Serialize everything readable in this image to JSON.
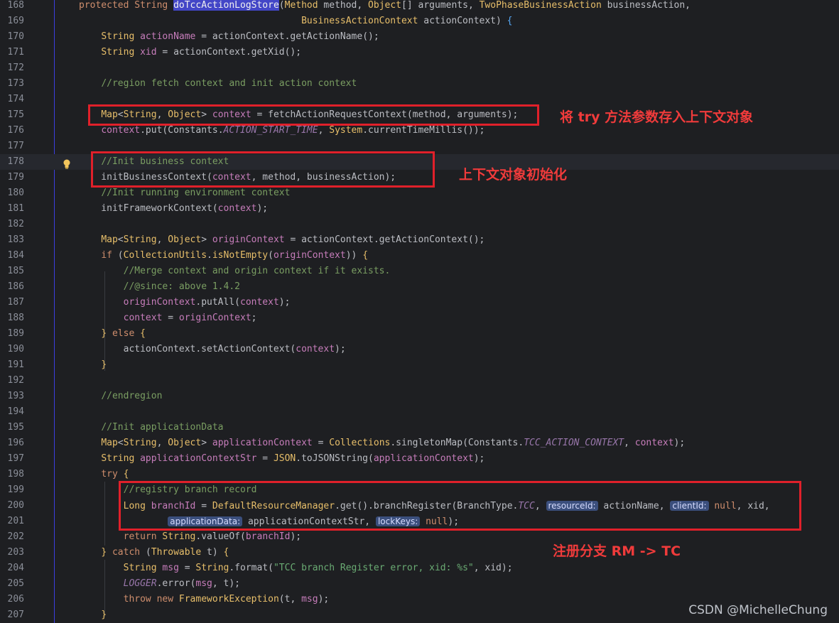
{
  "annotations": {
    "a1": "将 try 方法参数存入上下文对象",
    "a2": "上下文对象初始化",
    "a3": "注册分支 RM -> TC"
  },
  "watermark": "CSDN @MichelleChung",
  "lines": [
    {
      "n": "168",
      "s": [
        [
          "k",
          "protected "
        ],
        [
          "k",
          "String "
        ],
        [
          "method-hl",
          "doTccActionLogStore"
        ],
        [
          "t",
          "("
        ],
        [
          "ty",
          "Method "
        ],
        [
          "plain",
          "method, "
        ],
        [
          "ty",
          "Object"
        ],
        [
          "t",
          "[] "
        ],
        [
          "plain",
          "arguments, "
        ],
        [
          "ty",
          "TwoPhaseBusinessAction "
        ],
        [
          "plain",
          "businessAction,"
        ]
      ]
    },
    {
      "n": "169",
      "s": [
        [
          "plain",
          "                                        "
        ],
        [
          "ty",
          "BusinessActionContext "
        ],
        [
          "plain",
          "actionContext) "
        ],
        [
          "m",
          "{"
        ]
      ]
    },
    {
      "n": "170",
      "s": [
        [
          "plain",
          "    "
        ],
        [
          "ty",
          "String "
        ],
        [
          "p",
          "actionName "
        ],
        [
          "plain",
          "= actionContext.getActionName"
        ],
        [
          "t",
          "();"
        ]
      ]
    },
    {
      "n": "171",
      "s": [
        [
          "plain",
          "    "
        ],
        [
          "ty",
          "String "
        ],
        [
          "p",
          "xid "
        ],
        [
          "plain",
          "= actionContext.getXid"
        ],
        [
          "t",
          "();"
        ]
      ]
    },
    {
      "n": "172",
      "s": []
    },
    {
      "n": "173",
      "s": [
        [
          "plain",
          "    "
        ],
        [
          "c",
          "//region fetch context and init action context"
        ]
      ]
    },
    {
      "n": "174",
      "s": []
    },
    {
      "n": "175",
      "s": [
        [
          "plain",
          "    "
        ],
        [
          "ty",
          "Map"
        ],
        [
          "t",
          "<"
        ],
        [
          "ty",
          "String"
        ],
        [
          "t",
          ", "
        ],
        [
          "ty",
          "Object"
        ],
        [
          "t",
          "> "
        ],
        [
          "p",
          "context "
        ],
        [
          "plain",
          "= fetchActionRequestContext"
        ],
        [
          "t",
          "("
        ],
        [
          "plain",
          "method, arguments"
        ],
        [
          "t",
          ");"
        ]
      ]
    },
    {
      "n": "176",
      "s": [
        [
          "plain",
          "    "
        ],
        [
          "p",
          "context"
        ],
        [
          "plain",
          ".put"
        ],
        [
          "t",
          "("
        ],
        [
          "plain",
          "Constants."
        ],
        [
          "cn",
          "ACTION_START_TIME"
        ],
        [
          "t",
          ", "
        ],
        [
          "ty",
          "System"
        ],
        [
          "plain",
          ".currentTimeMillis"
        ],
        [
          "t",
          "());"
        ]
      ]
    },
    {
      "n": "177",
      "s": []
    },
    {
      "n": "178",
      "s": [
        [
          "plain",
          "    "
        ],
        [
          "c",
          "//Init business context"
        ]
      ]
    },
    {
      "n": "179",
      "s": [
        [
          "plain",
          "    initBusinessContext"
        ],
        [
          "t",
          "("
        ],
        [
          "p",
          "context"
        ],
        [
          "plain",
          ", method, businessAction"
        ],
        [
          "t",
          ");"
        ]
      ]
    },
    {
      "n": "180",
      "s": [
        [
          "plain",
          "    "
        ],
        [
          "c",
          "//Init running environment context"
        ]
      ]
    },
    {
      "n": "181",
      "s": [
        [
          "plain",
          "    initFrameworkContext"
        ],
        [
          "t",
          "("
        ],
        [
          "p",
          "context"
        ],
        [
          "t",
          ");"
        ]
      ]
    },
    {
      "n": "182",
      "s": []
    },
    {
      "n": "183",
      "s": [
        [
          "plain",
          "    "
        ],
        [
          "ty",
          "Map"
        ],
        [
          "t",
          "<"
        ],
        [
          "ty",
          "String"
        ],
        [
          "t",
          ", "
        ],
        [
          "ty",
          "Object"
        ],
        [
          "t",
          "> "
        ],
        [
          "p",
          "originContext "
        ],
        [
          "plain",
          "= actionContext.getActionContext"
        ],
        [
          "t",
          "();"
        ]
      ]
    },
    {
      "n": "184",
      "s": [
        [
          "plain",
          "    "
        ],
        [
          "k",
          "if "
        ],
        [
          "t",
          "("
        ],
        [
          "ty",
          "CollectionUtils"
        ],
        [
          "plain",
          "."
        ],
        [
          "ty",
          "isNotEmpty"
        ],
        [
          "t",
          "("
        ],
        [
          "p",
          "originContext"
        ],
        [
          "t",
          ")) "
        ],
        [
          "ty",
          "{"
        ]
      ]
    },
    {
      "n": "185",
      "s": [
        [
          "plain",
          "        "
        ],
        [
          "c",
          "//Merge context and origin context if it exists."
        ]
      ]
    },
    {
      "n": "186",
      "s": [
        [
          "plain",
          "        "
        ],
        [
          "c",
          "//@since: above 1.4.2"
        ]
      ]
    },
    {
      "n": "187",
      "s": [
        [
          "plain",
          "        "
        ],
        [
          "p",
          "originContext"
        ],
        [
          "plain",
          ".putAll"
        ],
        [
          "t",
          "("
        ],
        [
          "p",
          "context"
        ],
        [
          "t",
          ");"
        ]
      ]
    },
    {
      "n": "188",
      "s": [
        [
          "plain",
          "        "
        ],
        [
          "p",
          "context "
        ],
        [
          "plain",
          "= "
        ],
        [
          "p",
          "originContext"
        ],
        [
          "t",
          ";"
        ]
      ]
    },
    {
      "n": "189",
      "s": [
        [
          "plain",
          "    "
        ],
        [
          "ty",
          "} "
        ],
        [
          "k",
          "else "
        ],
        [
          "ty",
          "{"
        ]
      ]
    },
    {
      "n": "190",
      "s": [
        [
          "plain",
          "        actionContext.setActionContext"
        ],
        [
          "t",
          "("
        ],
        [
          "p",
          "context"
        ],
        [
          "t",
          ");"
        ]
      ]
    },
    {
      "n": "191",
      "s": [
        [
          "plain",
          "    "
        ],
        [
          "ty",
          "}"
        ]
      ]
    },
    {
      "n": "192",
      "s": []
    },
    {
      "n": "193",
      "s": [
        [
          "plain",
          "    "
        ],
        [
          "c",
          "//endregion"
        ]
      ]
    },
    {
      "n": "194",
      "s": []
    },
    {
      "n": "195",
      "s": [
        [
          "plain",
          "    "
        ],
        [
          "c",
          "//Init applicationData"
        ]
      ]
    },
    {
      "n": "196",
      "s": [
        [
          "plain",
          "    "
        ],
        [
          "ty",
          "Map"
        ],
        [
          "t",
          "<"
        ],
        [
          "ty",
          "String"
        ],
        [
          "t",
          ", "
        ],
        [
          "ty",
          "Object"
        ],
        [
          "t",
          "> "
        ],
        [
          "p",
          "applicationContext "
        ],
        [
          "plain",
          "= "
        ],
        [
          "ty",
          "Collections"
        ],
        [
          "plain",
          ".singletonMap"
        ],
        [
          "t",
          "("
        ],
        [
          "plain",
          "Constants."
        ],
        [
          "cn",
          "TCC_ACTION_CONTEXT"
        ],
        [
          "t",
          ", "
        ],
        [
          "p",
          "context"
        ],
        [
          "t",
          ");"
        ]
      ]
    },
    {
      "n": "197",
      "s": [
        [
          "plain",
          "    "
        ],
        [
          "ty",
          "String "
        ],
        [
          "p",
          "applicationContextStr "
        ],
        [
          "plain",
          "= "
        ],
        [
          "ty",
          "JSON"
        ],
        [
          "plain",
          ".toJSONString"
        ],
        [
          "t",
          "("
        ],
        [
          "p",
          "applicationContext"
        ],
        [
          "t",
          ");"
        ]
      ]
    },
    {
      "n": "198",
      "s": [
        [
          "plain",
          "    "
        ],
        [
          "k",
          "try "
        ],
        [
          "ty",
          "{"
        ]
      ]
    },
    {
      "n": "199",
      "s": [
        [
          "plain",
          "        "
        ],
        [
          "c",
          "//registry branch record"
        ]
      ]
    },
    {
      "n": "200",
      "s": [
        [
          "plain",
          "        "
        ],
        [
          "ty",
          "Long "
        ],
        [
          "p",
          "branchId "
        ],
        [
          "plain",
          "= "
        ],
        [
          "ty",
          "DefaultResourceManager"
        ],
        [
          "plain",
          ".get"
        ],
        [
          "t",
          "()"
        ],
        [
          "plain",
          ".branchRegister"
        ],
        [
          "t",
          "("
        ],
        [
          "plain",
          "BranchType."
        ],
        [
          "cn",
          "TCC"
        ],
        [
          "t",
          ", "
        ],
        [
          "hint",
          "resourceId:"
        ],
        [
          "plain",
          " actionName, "
        ],
        [
          "hint",
          "clientId:"
        ],
        [
          "k",
          " null"
        ],
        [
          "t",
          ", "
        ],
        [
          "plain",
          "xid,"
        ]
      ]
    },
    {
      "n": "201",
      "s": [
        [
          "plain",
          "                "
        ],
        [
          "hint",
          "applicationData:"
        ],
        [
          "plain",
          " applicationContextStr, "
        ],
        [
          "hint",
          "lockKeys:"
        ],
        [
          "k",
          " null"
        ],
        [
          "t",
          ");"
        ]
      ]
    },
    {
      "n": "202",
      "s": [
        [
          "plain",
          "        "
        ],
        [
          "k",
          "return "
        ],
        [
          "ty",
          "String"
        ],
        [
          "plain",
          ".valueOf"
        ],
        [
          "t",
          "("
        ],
        [
          "p",
          "branchId"
        ],
        [
          "t",
          ");"
        ]
      ]
    },
    {
      "n": "203",
      "s": [
        [
          "plain",
          "    "
        ],
        [
          "ty",
          "} "
        ],
        [
          "k",
          "catch "
        ],
        [
          "t",
          "("
        ],
        [
          "ty",
          "Throwable "
        ],
        [
          "plain",
          "t"
        ],
        [
          "t",
          ") "
        ],
        [
          "ty",
          "{"
        ]
      ]
    },
    {
      "n": "204",
      "s": [
        [
          "plain",
          "        "
        ],
        [
          "ty",
          "String "
        ],
        [
          "p",
          "msg "
        ],
        [
          "plain",
          "= "
        ],
        [
          "ty",
          "String"
        ],
        [
          "plain",
          ".format"
        ],
        [
          "t",
          "("
        ],
        [
          "s",
          "\"TCC branch Register error, xid: %s\""
        ],
        [
          "t",
          ", "
        ],
        [
          "plain",
          "xid"
        ],
        [
          "t",
          ");"
        ]
      ]
    },
    {
      "n": "205",
      "s": [
        [
          "plain",
          "        "
        ],
        [
          "cn",
          "LOGGER"
        ],
        [
          "plain",
          ".error"
        ],
        [
          "t",
          "("
        ],
        [
          "p",
          "msg"
        ],
        [
          "t",
          ", "
        ],
        [
          "plain",
          "t"
        ],
        [
          "t",
          ");"
        ]
      ]
    },
    {
      "n": "206",
      "s": [
        [
          "plain",
          "        "
        ],
        [
          "k",
          "throw new "
        ],
        [
          "ty",
          "FrameworkException"
        ],
        [
          "t",
          "("
        ],
        [
          "plain",
          "t, "
        ],
        [
          "p",
          "msg"
        ],
        [
          "t",
          ");"
        ]
      ]
    },
    {
      "n": "207",
      "s": [
        [
          "plain",
          "    "
        ],
        [
          "ty",
          "}"
        ]
      ]
    }
  ]
}
